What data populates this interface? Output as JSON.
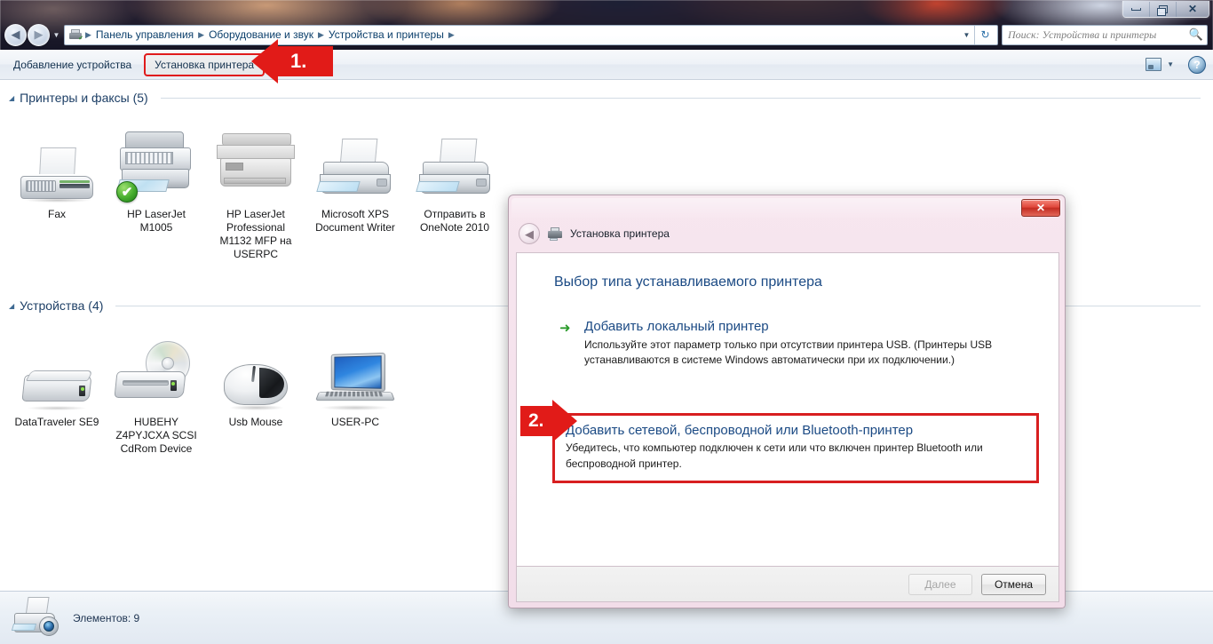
{
  "window": {
    "controls": {
      "minimize": "minimize",
      "maximize": "maximize",
      "close": "close"
    }
  },
  "address_bar": {
    "back_label": "◀",
    "forward_label": "▶",
    "history_caret": "▼",
    "crumbs": [
      "Панель управления",
      "Оборудование и звук",
      "Устройства и принтеры"
    ],
    "crumb_separator": "▶",
    "dropdown_caret": "▼",
    "refresh_label": "↻",
    "search_placeholder": "Поиск: Устройства и принтеры",
    "search_icon": "search-icon"
  },
  "toolbar": {
    "add_device_label": "Добавление устройства",
    "install_printer_label": "Установка принтера",
    "view_caret": "▼",
    "help_label": "?"
  },
  "groups": [
    {
      "title": "Принтеры и факсы (5)",
      "triangle": "◢",
      "items": [
        {
          "label": "Fax",
          "icon": "fax-icon"
        },
        {
          "label": "HP LaserJet\nM1005",
          "icon": "printer-mfp-icon",
          "default": true,
          "check": "✔"
        },
        {
          "label": "HP LaserJet\nProfessional\nM1132 MFP на\nUSERPC",
          "icon": "printer-mfp-offline-icon"
        },
        {
          "label": "Microsoft XPS\nDocument Writer",
          "icon": "printer-inkjet-icon"
        },
        {
          "label": "Отправить в\nOneNote 2010",
          "icon": "printer-inkjet-icon"
        }
      ]
    },
    {
      "title": "Устройства (4)",
      "triangle": "◢",
      "items": [
        {
          "label": "DataTraveler SE9",
          "icon": "usb-drive-icon"
        },
        {
          "label": "HUBEHY\nZ4PYJCXA SCSI\nCdRom Device",
          "icon": "cdrom-drive-icon"
        },
        {
          "label": "Usb Mouse",
          "icon": "mouse-icon"
        },
        {
          "label": "USER-PC",
          "icon": "laptop-icon"
        }
      ]
    }
  ],
  "status_bar": {
    "text": "Элементов: 9",
    "icon": "printer-camera-icon"
  },
  "dialog": {
    "close_label": "✕",
    "back_label": "◀",
    "printer_icon": "printer-icon",
    "title": "Установка принтера",
    "heading": "Выбор типа устанавливаемого принтера",
    "options": [
      {
        "arrow": "➜",
        "title": "Добавить локальный принтер",
        "description": "Используйте этот параметр только при отсутствии принтера USB. (Принтеры USB устанавливаются в системе Windows автоматически при их подключении.)",
        "highlighted": false
      },
      {
        "title": "Добавить сетевой, беспроводной или Bluetooth-принтер",
        "description": "Убедитесь, что компьютер подключен к сети или что включен принтер Bluetooth или беспроводной принтер.",
        "highlighted": true
      }
    ],
    "buttons": {
      "next_label": "Далее",
      "cancel_label": "Отмена"
    }
  },
  "callouts": [
    {
      "number": "1.",
      "direction": "left",
      "color": "#e11b18"
    },
    {
      "number": "2.",
      "direction": "right",
      "color": "#e11b18"
    }
  ]
}
